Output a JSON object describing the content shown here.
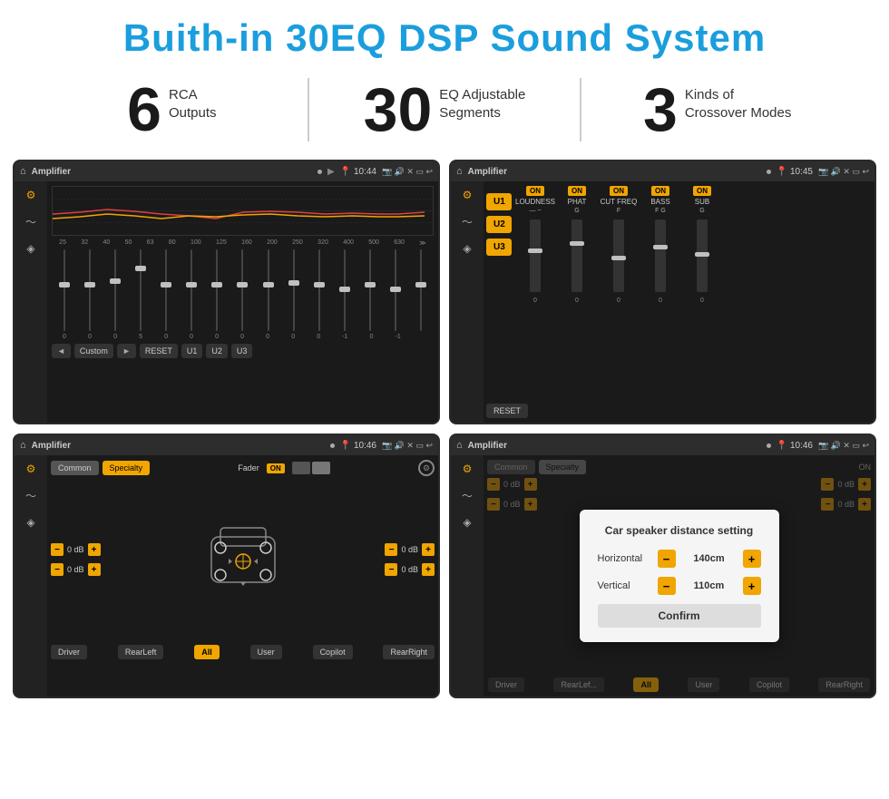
{
  "header": {
    "title": "Buith-in 30EQ DSP Sound System"
  },
  "stats": [
    {
      "number": "6",
      "label": "RCA\nOutputs"
    },
    {
      "number": "30",
      "label": "EQ Adjustable\nSegments"
    },
    {
      "number": "3",
      "label": "Kinds of\nCrossover Modes"
    }
  ],
  "screens": [
    {
      "id": "eq-screen",
      "topbar": {
        "title": "Amplifier",
        "time": "10:44"
      },
      "type": "eq",
      "freqs": [
        "25",
        "32",
        "40",
        "50",
        "63",
        "80",
        "100",
        "125",
        "160",
        "200",
        "250",
        "320",
        "400",
        "500",
        "630"
      ],
      "values": [
        "0",
        "0",
        "0",
        "5",
        "0",
        "0",
        "0",
        "0",
        "0",
        "0",
        "0",
        "-1",
        "0",
        "-1",
        ""
      ],
      "controls": [
        "◄",
        "Custom",
        "►",
        "RESET",
        "U1",
        "U2",
        "U3"
      ]
    },
    {
      "id": "amp-screen",
      "topbar": {
        "title": "Amplifier",
        "time": "10:45"
      },
      "type": "amplifier",
      "uButtons": [
        "U1",
        "U2",
        "U3"
      ],
      "channels": [
        {
          "label": "LOUDNESS",
          "on": true
        },
        {
          "label": "PHAT",
          "on": true
        },
        {
          "label": "CUT FREQ",
          "on": true
        },
        {
          "label": "BASS",
          "on": true
        },
        {
          "label": "SUB",
          "on": true
        }
      ],
      "resetLabel": "RESET"
    },
    {
      "id": "cross-screen",
      "topbar": {
        "title": "Amplifier",
        "time": "10:46"
      },
      "type": "crossover",
      "tabs": [
        "Common",
        "Specialty"
      ],
      "faderLabel": "Fader",
      "rows": [
        {
          "label": "— 0 dB +",
          "top": true
        },
        {
          "label": "— 0 dB +",
          "top": false
        }
      ],
      "buttons": [
        "Driver",
        "RearLeft",
        "All",
        "User",
        "Copilot",
        "RearRight"
      ]
    },
    {
      "id": "dist-screen",
      "topbar": {
        "title": "Amplifier",
        "time": "10:46"
      },
      "type": "distance",
      "dialog": {
        "title": "Car speaker distance setting",
        "horizontal": {
          "label": "Horizontal",
          "value": "140cm"
        },
        "vertical": {
          "label": "Vertical",
          "value": "110cm"
        },
        "confirmLabel": "Confirm"
      },
      "buttons": [
        "Driver",
        "RearLeft",
        "All",
        "User",
        "Copilot",
        "RearRight"
      ],
      "dbValues": [
        "0 dB",
        "0 dB"
      ]
    }
  ]
}
